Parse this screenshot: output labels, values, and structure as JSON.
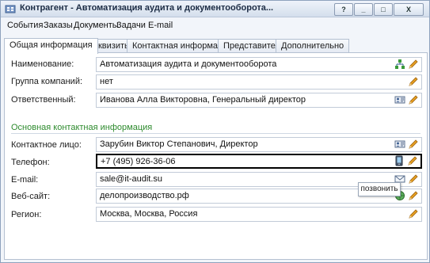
{
  "window": {
    "title": "Контрагент - Автоматизация аудита и документооборота...",
    "help_label": "?",
    "minimize_label": "_",
    "maximize_label": "□",
    "close_label": "X"
  },
  "menu": [
    "События",
    "Заказы",
    "Документы",
    "Задачи",
    "E-mail"
  ],
  "tabs": [
    {
      "label": "Общая информация",
      "active": true
    },
    {
      "label": "Реквизиты",
      "active": false
    },
    {
      "label": "Контактная информация",
      "active": false
    },
    {
      "label": "Представители",
      "active": false
    },
    {
      "label": "Дополнительно",
      "active": false
    }
  ],
  "fields": {
    "name": {
      "label": "Наименование:",
      "value": "Автоматизация аудита и документооборота"
    },
    "group": {
      "label": "Группа компаний:",
      "value": "нет"
    },
    "responsible": {
      "label": "Ответственный:",
      "value": "Иванова Алла Викторовна, Генеральный директор"
    },
    "contact_person": {
      "label": "Контактное лицо:",
      "value": "Зарубин Виктор Степанович, Директор"
    },
    "phone": {
      "label": "Телефон:",
      "value": "+7 (495) 926-36-06"
    },
    "email": {
      "label": "E-mail:",
      "value": "sale@it-audit.su"
    },
    "website": {
      "label": "Веб-сайт:",
      "value": "делопроизводство.рф"
    },
    "region": {
      "label": "Регион:",
      "value": "Москва, Москва, Россия"
    }
  },
  "section": {
    "title": "Основная контактная информация"
  },
  "tooltip": {
    "text": "позвонить"
  },
  "colors": {
    "section_title": "#2e8b2e",
    "edit_icon": "#e8a020"
  }
}
